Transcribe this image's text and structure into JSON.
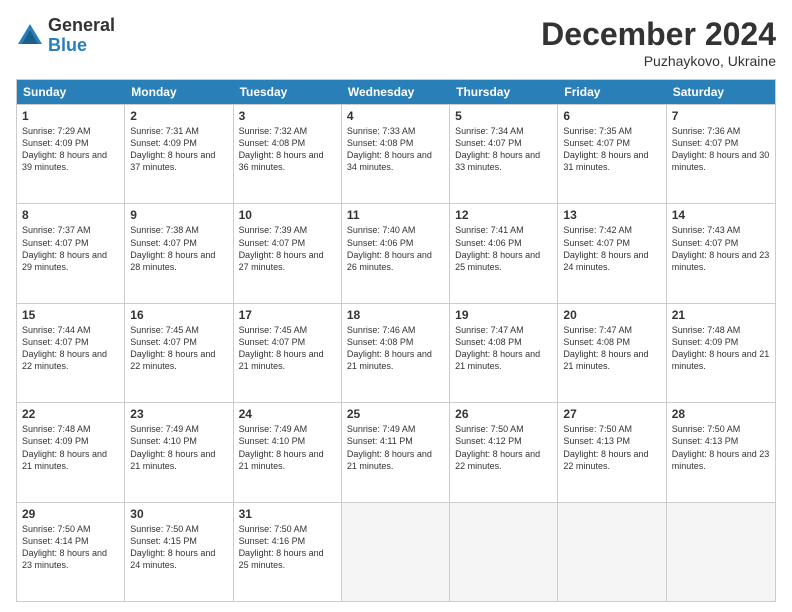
{
  "logo": {
    "general": "General",
    "blue": "Blue"
  },
  "header": {
    "month": "December 2024",
    "location": "Puzhaykovo, Ukraine"
  },
  "days": [
    "Sunday",
    "Monday",
    "Tuesday",
    "Wednesday",
    "Thursday",
    "Friday",
    "Saturday"
  ],
  "weeks": [
    [
      {
        "day": "1",
        "sunrise": "7:29 AM",
        "sunset": "4:09 PM",
        "daylight": "8 hours and 39 minutes."
      },
      {
        "day": "2",
        "sunrise": "7:31 AM",
        "sunset": "4:09 PM",
        "daylight": "8 hours and 37 minutes."
      },
      {
        "day": "3",
        "sunrise": "7:32 AM",
        "sunset": "4:08 PM",
        "daylight": "8 hours and 36 minutes."
      },
      {
        "day": "4",
        "sunrise": "7:33 AM",
        "sunset": "4:08 PM",
        "daylight": "8 hours and 34 minutes."
      },
      {
        "day": "5",
        "sunrise": "7:34 AM",
        "sunset": "4:07 PM",
        "daylight": "8 hours and 33 minutes."
      },
      {
        "day": "6",
        "sunrise": "7:35 AM",
        "sunset": "4:07 PM",
        "daylight": "8 hours and 31 minutes."
      },
      {
        "day": "7",
        "sunrise": "7:36 AM",
        "sunset": "4:07 PM",
        "daylight": "8 hours and 30 minutes."
      }
    ],
    [
      {
        "day": "8",
        "sunrise": "7:37 AM",
        "sunset": "4:07 PM",
        "daylight": "8 hours and 29 minutes."
      },
      {
        "day": "9",
        "sunrise": "7:38 AM",
        "sunset": "4:07 PM",
        "daylight": "8 hours and 28 minutes."
      },
      {
        "day": "10",
        "sunrise": "7:39 AM",
        "sunset": "4:07 PM",
        "daylight": "8 hours and 27 minutes."
      },
      {
        "day": "11",
        "sunrise": "7:40 AM",
        "sunset": "4:06 PM",
        "daylight": "8 hours and 26 minutes."
      },
      {
        "day": "12",
        "sunrise": "7:41 AM",
        "sunset": "4:06 PM",
        "daylight": "8 hours and 25 minutes."
      },
      {
        "day": "13",
        "sunrise": "7:42 AM",
        "sunset": "4:07 PM",
        "daylight": "8 hours and 24 minutes."
      },
      {
        "day": "14",
        "sunrise": "7:43 AM",
        "sunset": "4:07 PM",
        "daylight": "8 hours and 23 minutes."
      }
    ],
    [
      {
        "day": "15",
        "sunrise": "7:44 AM",
        "sunset": "4:07 PM",
        "daylight": "8 hours and 22 minutes."
      },
      {
        "day": "16",
        "sunrise": "7:45 AM",
        "sunset": "4:07 PM",
        "daylight": "8 hours and 22 minutes."
      },
      {
        "day": "17",
        "sunrise": "7:45 AM",
        "sunset": "4:07 PM",
        "daylight": "8 hours and 21 minutes."
      },
      {
        "day": "18",
        "sunrise": "7:46 AM",
        "sunset": "4:08 PM",
        "daylight": "8 hours and 21 minutes."
      },
      {
        "day": "19",
        "sunrise": "7:47 AM",
        "sunset": "4:08 PM",
        "daylight": "8 hours and 21 minutes."
      },
      {
        "day": "20",
        "sunrise": "7:47 AM",
        "sunset": "4:08 PM",
        "daylight": "8 hours and 21 minutes."
      },
      {
        "day": "21",
        "sunrise": "7:48 AM",
        "sunset": "4:09 PM",
        "daylight": "8 hours and 21 minutes."
      }
    ],
    [
      {
        "day": "22",
        "sunrise": "7:48 AM",
        "sunset": "4:09 PM",
        "daylight": "8 hours and 21 minutes."
      },
      {
        "day": "23",
        "sunrise": "7:49 AM",
        "sunset": "4:10 PM",
        "daylight": "8 hours and 21 minutes."
      },
      {
        "day": "24",
        "sunrise": "7:49 AM",
        "sunset": "4:10 PM",
        "daylight": "8 hours and 21 minutes."
      },
      {
        "day": "25",
        "sunrise": "7:49 AM",
        "sunset": "4:11 PM",
        "daylight": "8 hours and 21 minutes."
      },
      {
        "day": "26",
        "sunrise": "7:50 AM",
        "sunset": "4:12 PM",
        "daylight": "8 hours and 22 minutes."
      },
      {
        "day": "27",
        "sunrise": "7:50 AM",
        "sunset": "4:13 PM",
        "daylight": "8 hours and 22 minutes."
      },
      {
        "day": "28",
        "sunrise": "7:50 AM",
        "sunset": "4:13 PM",
        "daylight": "8 hours and 23 minutes."
      }
    ],
    [
      {
        "day": "29",
        "sunrise": "7:50 AM",
        "sunset": "4:14 PM",
        "daylight": "8 hours and 23 minutes."
      },
      {
        "day": "30",
        "sunrise": "7:50 AM",
        "sunset": "4:15 PM",
        "daylight": "8 hours and 24 minutes."
      },
      {
        "day": "31",
        "sunrise": "7:50 AM",
        "sunset": "4:16 PM",
        "daylight": "8 hours and 25 minutes."
      },
      null,
      null,
      null,
      null
    ]
  ]
}
